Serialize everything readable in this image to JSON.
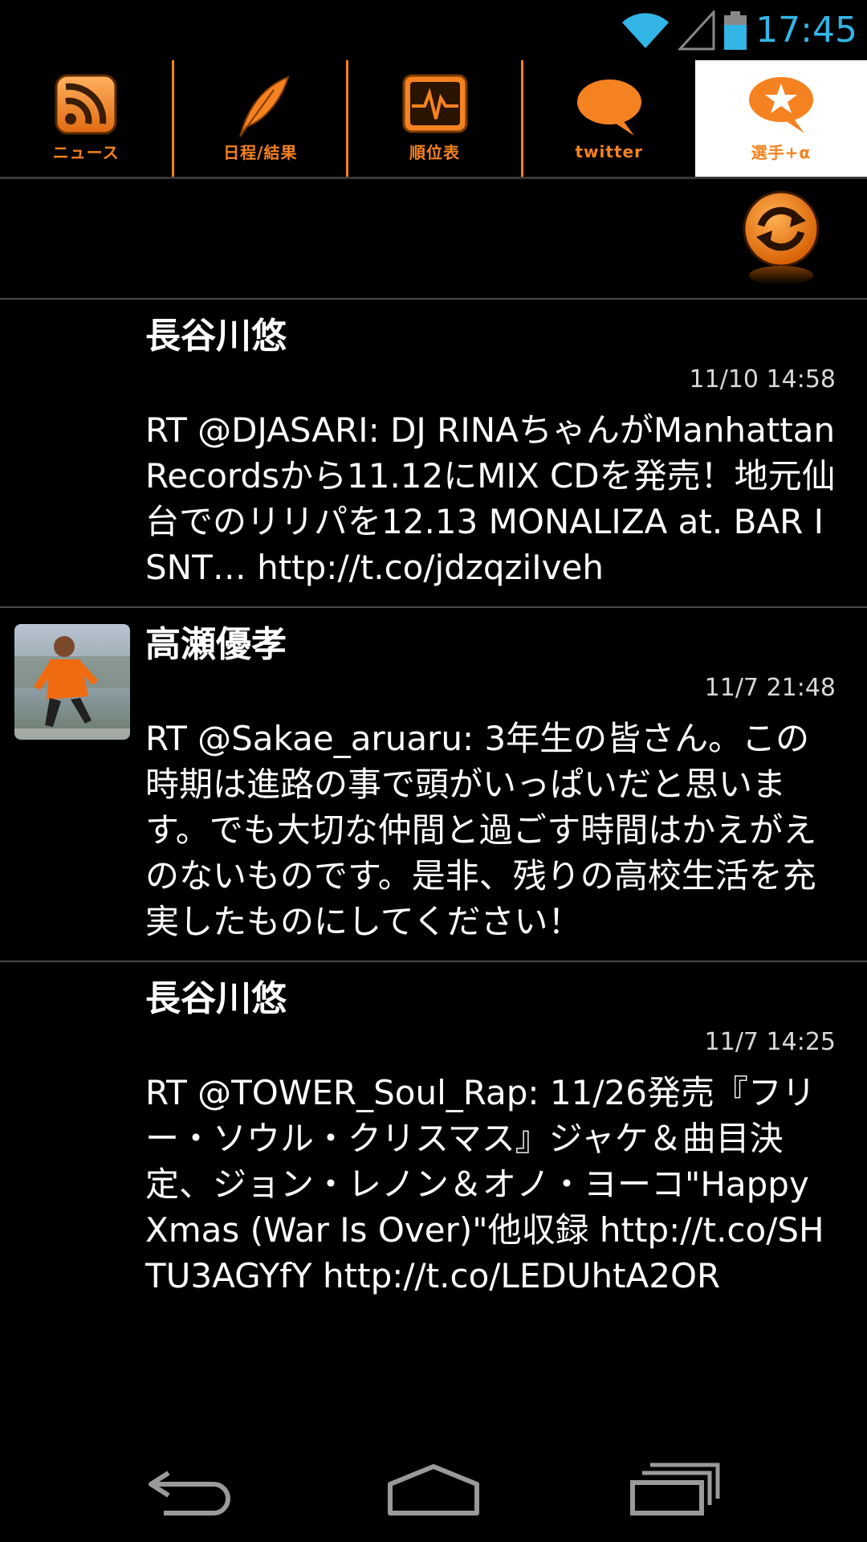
{
  "status_bar": {
    "time": "17:45",
    "clock_color": "#33b5e5"
  },
  "tabs": [
    {
      "label": "ニュース",
      "icon": "rss-icon"
    },
    {
      "label": "日程/結果",
      "icon": "quill-icon"
    },
    {
      "label": "順位表",
      "icon": "pulse-chart-icon"
    },
    {
      "label": "twitter",
      "icon": "speech-bubble-icon"
    },
    {
      "label": "選手+α",
      "icon": "star-bubble-icon",
      "active": true
    }
  ],
  "accent_color": "#f58220",
  "tweets": [
    {
      "user": "長谷川悠",
      "time": "11/10 14:58",
      "text": "RT @DJASARI: DJ RINAちゃんがManhattan Recordsから11.12にMIX CDを発売！地元仙台でのリリパを12.13 MONALIZA at. BAR ISNT… http://t.co/jdzqziIveh",
      "has_avatar": false
    },
    {
      "user": "高瀬優孝",
      "time": "11/7 21:48",
      "text": "RT @Sakae_aruaru: 3年生の皆さん。この時期は進路の事で頭がいっぱいだと思います。でも大切な仲間と過ごす時間はかえがえのないものです。是非、残りの高校生活を充実したものにしてください！",
      "has_avatar": true
    },
    {
      "user": "長谷川悠",
      "time": "11/7 14:25",
      "text": "RT @TOWER_Soul_Rap: 11/26発売『フリー・ソウル・クリスマス』ジャケ＆曲目決定、ジョン・レノン＆オノ・ヨーコ\"Happy Xmas (War Is Over)\"他収録 http://t.co/SHTU3AGYfY http://t.co/LEDUhtA2OR",
      "has_avatar": false
    }
  ]
}
